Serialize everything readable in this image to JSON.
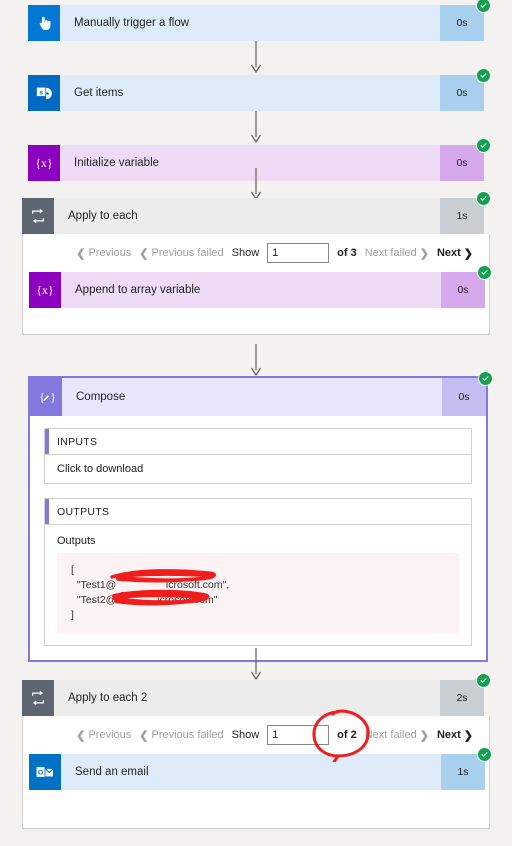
{
  "flow": {
    "steps": [
      {
        "name": "Manually trigger a flow",
        "duration": "0s",
        "icon": "pointing-hand-icon",
        "status": "succeeded",
        "theme": "t-blue"
      },
      {
        "name": "Get items",
        "duration": "0s",
        "icon": "sharepoint-icon",
        "status": "succeeded",
        "theme": "t-sp"
      },
      {
        "name": "Initialize variable",
        "duration": "0s",
        "icon": "variable-icon",
        "status": "succeeded",
        "theme": "t-var"
      }
    ]
  },
  "scope1": {
    "name": "Apply to each",
    "duration": "1s",
    "icon": "loop-icon",
    "status": "succeeded",
    "pager": {
      "previous": "Previous",
      "previous_failed": "Previous failed",
      "show_label": "Show",
      "page_value": "1",
      "of_label": "of 3",
      "next_failed": "Next failed",
      "next": "Next",
      "chevron_left": "❮",
      "chevron_right": "❯"
    },
    "child": {
      "name": "Append to array variable",
      "duration": "0s",
      "icon": "variable-icon",
      "status": "succeeded",
      "theme": "t-var"
    }
  },
  "compose": {
    "name": "Compose",
    "duration": "0s",
    "icon": "compose-icon",
    "status": "succeeded",
    "inputs": {
      "header": "INPUTS",
      "value": "Click to download"
    },
    "outputs": {
      "header": "OUTPUTS",
      "label": "Outputs",
      "code": "[\n  \"Test1@                 icrosoft.com\",\n  \"Test2@              icrosoft.com\"\n]"
    }
  },
  "scope2": {
    "name": "Apply to each 2",
    "duration": "2s",
    "icon": "loop-icon",
    "status": "succeeded",
    "pager": {
      "previous": "Previous",
      "previous_failed": "Previous failed",
      "show_label": "Show",
      "page_value": "1",
      "of_label": "of 2",
      "next_failed": "Next failed",
      "next": "Next",
      "chevron_left": "❮",
      "chevron_right": "❯"
    },
    "child": {
      "name": "Send an email",
      "duration": "1s",
      "icon": "outlook-icon",
      "status": "succeeded",
      "theme": "t-ol"
    }
  },
  "annotations": {
    "redaction_color": "#f01d1d",
    "scribble_1": "redaction-scribble",
    "scribble_2": "redaction-scribble",
    "circle": "highlight-circle-of-2"
  },
  "colors": {
    "success": "#12a150",
    "trigger": "#0078d4",
    "variable": "#8c00c0",
    "scope": "#5d6671",
    "compose": "#8378de",
    "outlook": "#0072c6",
    "annotation": "#f01d1d"
  }
}
